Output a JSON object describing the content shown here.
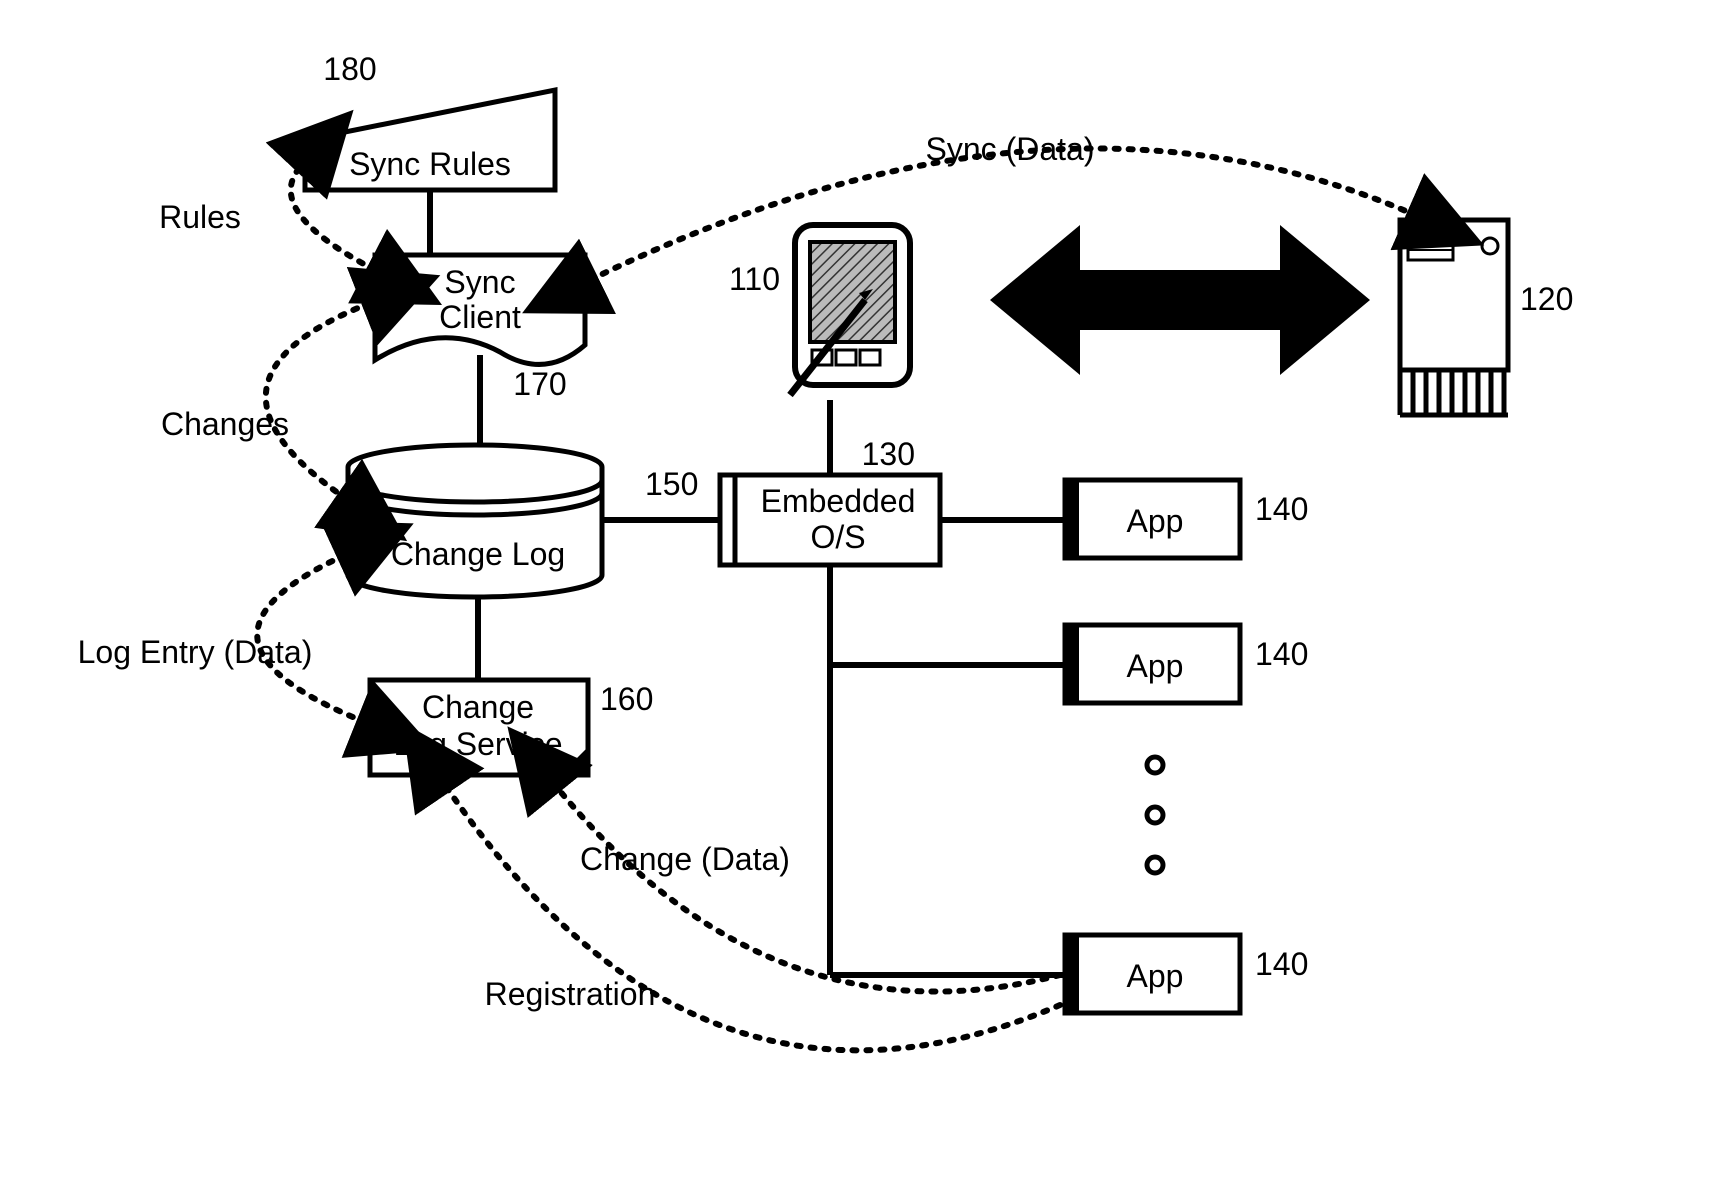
{
  "nodes": {
    "syncRules": {
      "id": "180",
      "label": "Sync Rules"
    },
    "syncClient": {
      "id": "170",
      "label1": "Sync",
      "label2": "Client"
    },
    "changeLog": {
      "id": "150",
      "label": "Change Log"
    },
    "changeLogSvc": {
      "id": "160",
      "label1": "Change",
      "label2": "Log Service"
    },
    "embeddedOS": {
      "id": "130",
      "label1": "Embedded",
      "label2": "O/S"
    },
    "pda": {
      "id": "110"
    },
    "server": {
      "id": "120"
    },
    "app1": {
      "id": "140",
      "label": "App"
    },
    "app2": {
      "id": "140",
      "label": "App"
    },
    "app3": {
      "id": "140",
      "label": "App"
    }
  },
  "edges": {
    "rules": "Rules",
    "changes": "Changes",
    "logEntry": "Log Entry (Data)",
    "changeData": "Change (Data)",
    "registration": "Registration",
    "syncData": "Sync (Data)"
  }
}
